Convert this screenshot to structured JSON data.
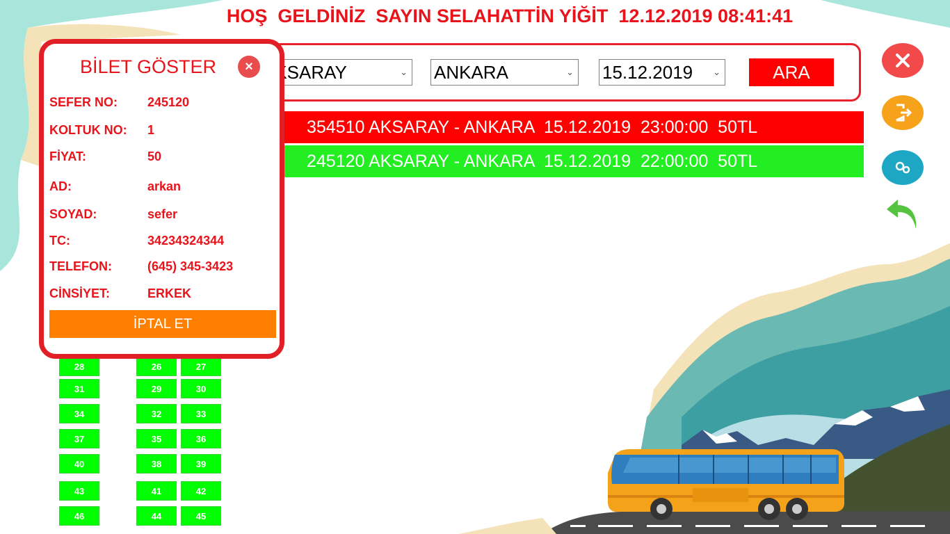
{
  "header": {
    "welcome": "HOŞ  GELDİNİZ  SAYIN SELAHATTİN YİĞİT  12.12.2019 08:41:41"
  },
  "search": {
    "from_value": "AKSARAY",
    "to_value": "ANKARA",
    "date_value": "15.12.2019",
    "search_label": "ARA"
  },
  "trips": [
    {
      "text": "354510 AKSARAY - ANKARA  15.12.2019  23:00:00  50TL",
      "color": "#ff0000"
    },
    {
      "text": "245120 AKSARAY - ANKARA  15.12.2019  22:00:00  50TL",
      "color": "#22ee22"
    }
  ],
  "side_buttons": [
    {
      "icon": "close-icon",
      "color": "#f24a4a"
    },
    {
      "icon": "logout-icon",
      "color": "#f7a21b"
    },
    {
      "icon": "settings-gears-icon",
      "color": "#1ea7c4"
    },
    {
      "icon": "back-arrow-icon",
      "color": "#55c240"
    }
  ],
  "ticket": {
    "title": "BİLET GÖSTER",
    "close_symbol": "×",
    "fields": [
      {
        "label": "SEFER NO:",
        "value": "245120"
      },
      {
        "label": "KOLTUK NO:",
        "value": "1"
      },
      {
        "label": "FİYAT:",
        "value": "50"
      },
      {
        "label": "AD:",
        "value": "arkan"
      },
      {
        "label": "SOYAD:",
        "value": "sefer"
      },
      {
        "label": "TC:",
        "value": "34234324344"
      },
      {
        "label": "TELEFON:",
        "value": "(645) 345-3423"
      },
      {
        "label": "CİNSİYET:",
        "value": "ERKEK"
      }
    ],
    "cancel_label": "İPTAL ET"
  },
  "seats": [
    "28",
    "26",
    "27",
    "31",
    "29",
    "30",
    "34",
    "32",
    "33",
    "37",
    "35",
    "36",
    "40",
    "38",
    "39",
    "43",
    "41",
    "42",
    "46",
    "44",
    "45"
  ]
}
